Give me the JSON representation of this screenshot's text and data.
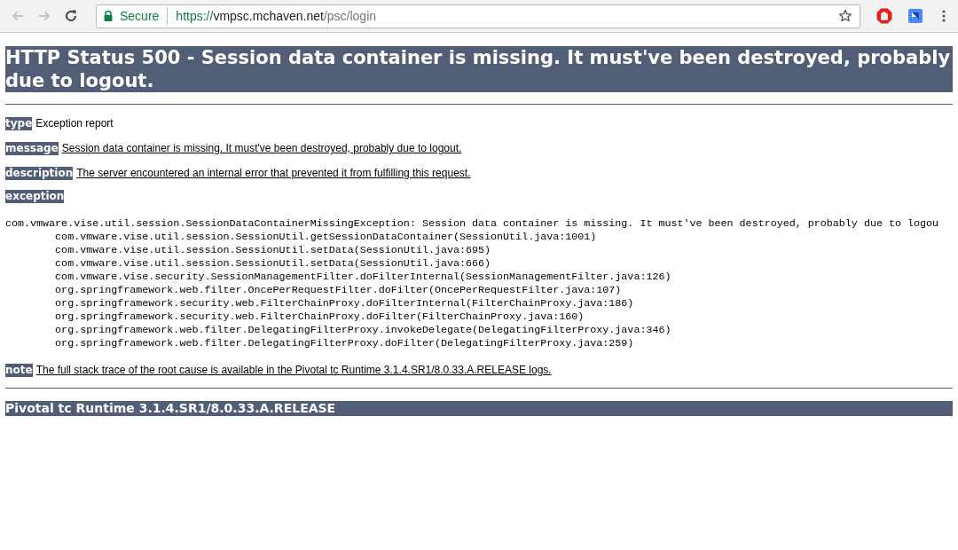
{
  "browser": {
    "nav": [
      {
        "kind": "back",
        "disabled": true
      },
      {
        "kind": "forward",
        "disabled": true
      },
      {
        "kind": "reload",
        "disabled": false
      }
    ],
    "address": {
      "secure_label": "Secure",
      "scheme": "https://",
      "host": "vmpsc.mchaven.net",
      "path": "/psc/login"
    }
  },
  "page": {
    "heading": "HTTP Status 500 - Session data container is missing. It must've been destroyed, probably due to logout.",
    "fields": [
      {
        "label": "type",
        "text": "Exception report",
        "underlined": false
      },
      {
        "label": "message",
        "text": "Session data container is missing. It must've been destroyed, probably due to logout.",
        "underlined": true
      },
      {
        "label": "description",
        "text": "The server encountered an internal error that prevented it from fulfilling this request.",
        "underlined": true
      },
      {
        "label": "exception"
      }
    ],
    "stack_trace": [
      "com.vmware.vise.util.session.SessionDataContainerMissingException: Session data container is missing. It must've been destroyed, probably due to logou",
      "\tcom.vmware.vise.util.session.SessionUtil.getSessionDataContainer(SessionUtil.java:1001)",
      "\tcom.vmware.vise.util.session.SessionUtil.setData(SessionUtil.java:695)",
      "\tcom.vmware.vise.util.session.SessionUtil.setData(SessionUtil.java:666)",
      "\tcom.vmware.vise.security.SessionManagementFilter.doFilterInternal(SessionManagementFilter.java:126)",
      "\torg.springframework.web.filter.OncePerRequestFilter.doFilter(OncePerRequestFilter.java:107)",
      "\torg.springframework.security.web.FilterChainProxy.doFilterInternal(FilterChainProxy.java:186)",
      "\torg.springframework.security.web.FilterChainProxy.doFilter(FilterChainProxy.java:160)",
      "\torg.springframework.web.filter.DelegatingFilterProxy.invokeDelegate(DelegatingFilterProxy.java:346)",
      "\torg.springframework.web.filter.DelegatingFilterProxy.doFilter(DelegatingFilterProxy.java:259)"
    ],
    "note": {
      "label": "note",
      "text": "The full stack trace of the root cause is available in the Pivotal tc Runtime 3.1.4.SR1/8.0.33.A.RELEASE logs.",
      "underlined": true
    },
    "footer": "Pivotal tc Runtime 3.1.4.SR1/8.0.33.A.RELEASE"
  }
}
